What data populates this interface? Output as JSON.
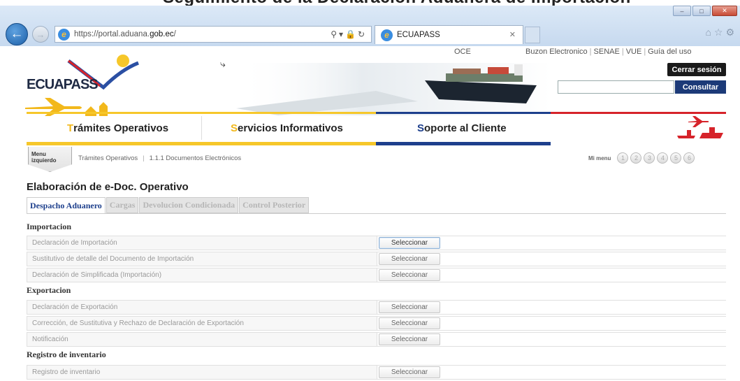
{
  "slide": {
    "title": "Seguimiento de la Declaración Aduanera de Importación"
  },
  "browser": {
    "url_prefix": "https://portal.aduana.",
    "url_domain": "gob.ec",
    "url_suffix": "/",
    "tab_title": "ECUAPASS",
    "window_controls": [
      "minimize-icon",
      "maximize-icon",
      "close-icon"
    ]
  },
  "header": {
    "logo_text": "ECUAPASS",
    "links": [
      "OCE",
      "Buzon Electronico",
      "SENAE",
      "VUE",
      "Guía del uso"
    ],
    "logout_label": "Cerrar sesión",
    "search_placeholder": "",
    "search_button": "Consultar"
  },
  "nav": {
    "items": [
      {
        "first": "T",
        "rest": "rámites Operativos",
        "selected": false
      },
      {
        "first": "S",
        "rest": "ervicios Informativos",
        "selected": false
      },
      {
        "first": "S",
        "rest": "oporte al Cliente",
        "selected": true
      }
    ],
    "colors": {
      "yellow": "#f6c72a",
      "blue": "#1d3f8c",
      "red": "#d6232a"
    }
  },
  "breadcrumb": {
    "menu_tab_line1": "Menu",
    "menu_tab_line2": "izquierdo",
    "items": [
      "Trámites Operativos",
      "1.1.1 Documentos Electrónicos"
    ],
    "my_menu_label": "Mi menu",
    "my_menu_slots": [
      "1",
      "2",
      "3",
      "4",
      "5",
      "6"
    ]
  },
  "content": {
    "title": "Elaboración de e-Doc. Operativo",
    "tabs": [
      {
        "label": "Despacho Aduanero",
        "active": true
      },
      {
        "label": "Cargas",
        "active": false
      },
      {
        "label": "Devolucion Condicionada",
        "active": false
      },
      {
        "label": "Control Posterior",
        "active": false
      }
    ],
    "button_label": "Seleccionar",
    "sections": [
      {
        "title": "Importacion",
        "rows": [
          "Declaración de Importación",
          "Sustitutivo de detalle del Documento de Importación",
          "Declaración de Simplificada (Importación)"
        ]
      },
      {
        "title": "Exportacion",
        "rows": [
          "Declaración de Exportación",
          "Corrección, de Sustitutiva y Rechazo de Declaración de Exportación",
          "Notificación"
        ]
      },
      {
        "title": "Registro de inventario",
        "rows": [
          "Registro de inventario"
        ]
      }
    ]
  }
}
